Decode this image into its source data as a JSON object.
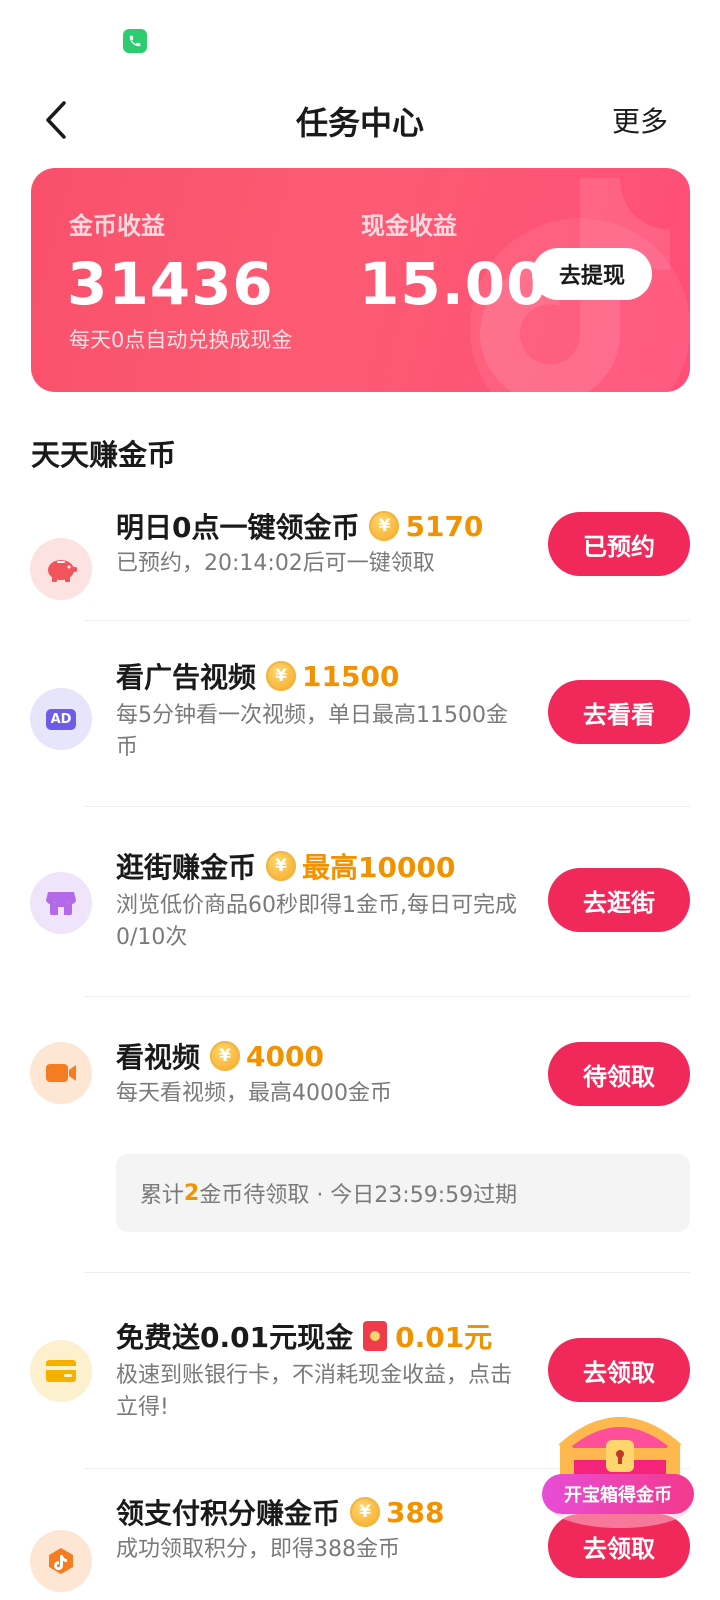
{
  "header": {
    "title": "任务中心",
    "more_label": "更多"
  },
  "earnings": {
    "coin_label": "金币收益",
    "coin_value": "31436",
    "coin_note": "每天0点自动兑换成现金",
    "cash_label": "现金收益",
    "cash_value": "15.00",
    "withdraw_label": "去提现"
  },
  "section": {
    "title": "天天赚金币"
  },
  "tasks": [
    {
      "title": "明日0点一键领金币",
      "coin_symbol": "¥",
      "reward": "5170",
      "desc": "已预约，20:14:02后可一键领取",
      "button": "已预约",
      "icon": "piggy-bank-icon"
    },
    {
      "title": "看广告视频",
      "coin_symbol": "¥",
      "reward": "11500",
      "desc": "每5分钟看一次视频，单日最高11500金币",
      "button": "去看看",
      "icon": "ad-icon",
      "icon_text": "AD"
    },
    {
      "title": "逛街赚金币",
      "coin_symbol": "¥",
      "reward": "最高10000",
      "desc": "浏览低价商品60秒即得1金币,每日可完成0/10次",
      "button": "去逛街",
      "icon": "shop-icon"
    },
    {
      "title": "看视频",
      "coin_symbol": "¥",
      "reward": "4000",
      "desc": "每天看视频，最高4000金币",
      "button": "待领取",
      "icon": "video-camera-icon",
      "pending": {
        "prefix": "累计",
        "count": "2",
        "suffix": "金币待领取 · 今日23:59:59过期"
      }
    },
    {
      "title": "免费送0.01元现金",
      "reward": "0.01元",
      "desc": "极速到账银行卡，不消耗现金收益，点击立得!",
      "button": "去领取",
      "icon": "bank-card-icon"
    },
    {
      "title": "领支付积分赚金币",
      "coin_symbol": "¥",
      "reward": "388",
      "desc": "成功领取积分，即得388金币",
      "button": "去领取",
      "icon": "points-icon"
    }
  ],
  "treasure": {
    "label": "开宝箱得金币"
  },
  "colors": {
    "accent": "#f0295a",
    "reward": "#f39200",
    "card_gradient_start": "#f9506b",
    "card_gradient_end": "#ff4e78"
  }
}
